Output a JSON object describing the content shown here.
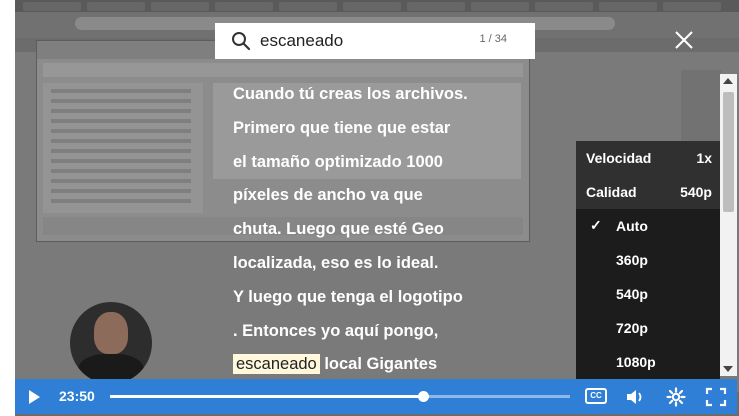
{
  "search": {
    "query": "escaneado",
    "match_count": "1 / 34"
  },
  "transcript": {
    "lines": [
      "Cuando tú creas los archivos.",
      "Primero que tiene que estar",
      "el tamaño optimizado 1000",
      "píxeles de ancho va que",
      "chuta. Luego que esté Geo",
      "localizada, eso es lo ideal.",
      "Y luego que tenga el logotipo",
      ". Entonces yo aquí pongo,"
    ],
    "last_line_highlight": "escaneado",
    "last_line_rest": " local Gigantes"
  },
  "settings_menu": {
    "speed_label": "Velocidad",
    "speed_value": "1x",
    "quality_label": "Calidad",
    "quality_value": "540p",
    "options": [
      "Auto",
      "360p",
      "540p",
      "720p",
      "1080p"
    ],
    "selected_option": "Auto"
  },
  "controls": {
    "current_time": "23:50",
    "progress_fraction": 0.68,
    "cc_label": "CC"
  },
  "colors": {
    "control_bar": "#2f7fd6",
    "highlight": "#fff8dc"
  }
}
